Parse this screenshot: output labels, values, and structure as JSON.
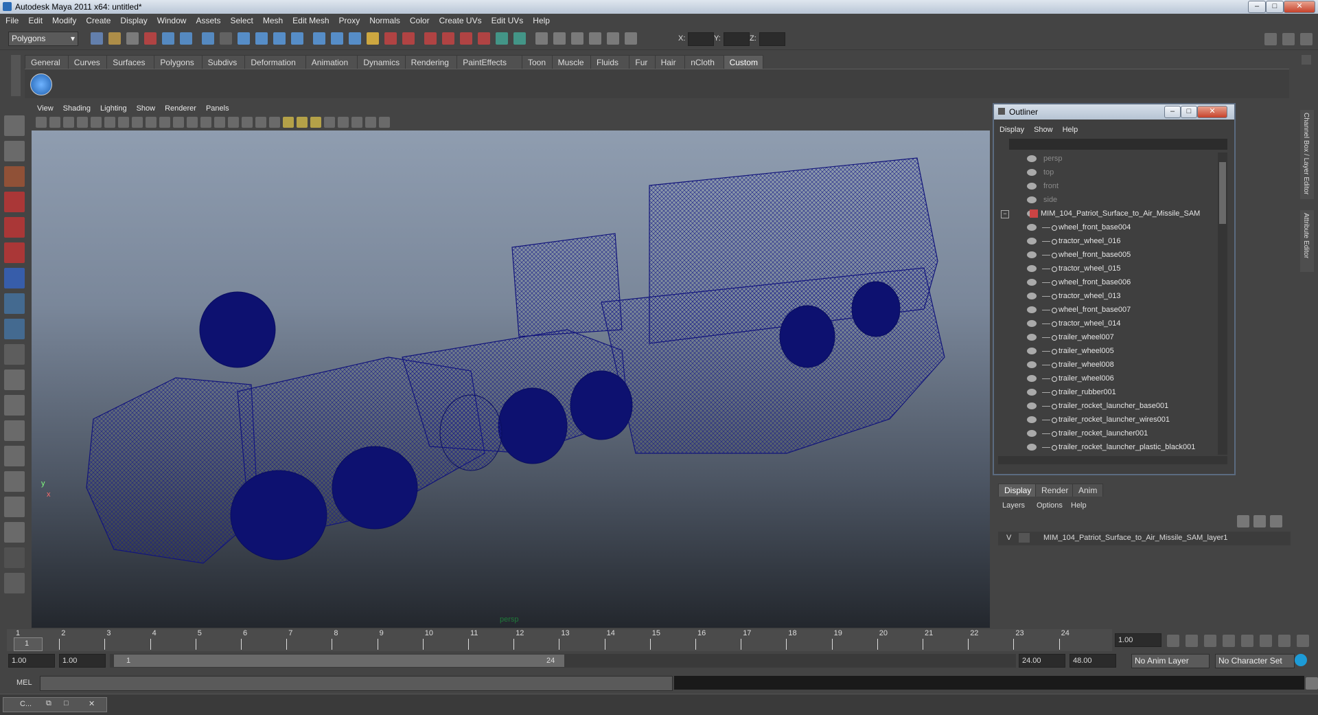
{
  "window": {
    "title": "Autodesk Maya 2011 x64: untitled*"
  },
  "menus": [
    "File",
    "Edit",
    "Modify",
    "Create",
    "Display",
    "Window",
    "Assets",
    "Select",
    "Mesh",
    "Edit Mesh",
    "Proxy",
    "Normals",
    "Color",
    "Create UVs",
    "Edit UVs",
    "Help"
  ],
  "status_line": {
    "mode": "Polygons",
    "x_label": "X:",
    "y_label": "Y:",
    "z_label": "Z:"
  },
  "shelf_tabs": [
    "General",
    "Curves",
    "Surfaces",
    "Polygons",
    "Subdivs",
    "Deformation",
    "Animation",
    "Dynamics",
    "Rendering",
    "PaintEffects",
    "Toon",
    "Muscle",
    "Fluids",
    "Fur",
    "Hair",
    "nCloth",
    "Custom"
  ],
  "active_shelf_tab": "Custom",
  "viewport": {
    "menus": [
      "View",
      "Shading",
      "Lighting",
      "Show",
      "Renderer",
      "Panels"
    ],
    "camera_label": "persp",
    "axis_y": "y",
    "axis_x": "x"
  },
  "outliner": {
    "title": "Outliner",
    "menus": [
      "Display",
      "Show",
      "Help"
    ],
    "items": [
      {
        "label": "persp",
        "dim": true
      },
      {
        "label": "top",
        "dim": true
      },
      {
        "label": "front",
        "dim": true
      },
      {
        "label": "side",
        "dim": true
      },
      {
        "label": "MIM_104_Patriot_Surface_to_Air_Missile_SAM",
        "dim": false
      },
      {
        "label": "wheel_front_base004",
        "dim": false
      },
      {
        "label": "tractor_wheel_016",
        "dim": false
      },
      {
        "label": "wheel_front_base005",
        "dim": false
      },
      {
        "label": "tractor_wheel_015",
        "dim": false
      },
      {
        "label": "wheel_front_base006",
        "dim": false
      },
      {
        "label": "tractor_wheel_013",
        "dim": false
      },
      {
        "label": "wheel_front_base007",
        "dim": false
      },
      {
        "label": "tractor_wheel_014",
        "dim": false
      },
      {
        "label": "trailer_wheel007",
        "dim": false
      },
      {
        "label": "trailer_wheel005",
        "dim": false
      },
      {
        "label": "trailer_wheel008",
        "dim": false
      },
      {
        "label": "trailer_wheel006",
        "dim": false
      },
      {
        "label": "trailer_rubber001",
        "dim": false
      },
      {
        "label": "trailer_rocket_launcher_base001",
        "dim": false
      },
      {
        "label": "trailer_rocket_launcher_wires001",
        "dim": false
      },
      {
        "label": "trailer_rocket_launcher001",
        "dim": false
      },
      {
        "label": "trailer_rocket_launcher_plastic_black001",
        "dim": false
      }
    ]
  },
  "side_tabs": {
    "channel_box": "Channel Box / Layer Editor",
    "attribute_editor": "Attribute Editor"
  },
  "layer_editor": {
    "tabs": [
      "Display",
      "Render",
      "Anim"
    ],
    "menus": [
      "Layers",
      "Options",
      "Help"
    ],
    "layer": {
      "visible_flag": "V",
      "name": "MIM_104_Patriot_Surface_to_Air_Missile_SAM_layer1"
    }
  },
  "timeline": {
    "ticks": [
      "1",
      "2",
      "3",
      "4",
      "5",
      "6",
      "7",
      "8",
      "9",
      "10",
      "11",
      "12",
      "13",
      "14",
      "15",
      "16",
      "17",
      "18",
      "19",
      "20",
      "21",
      "22",
      "23",
      "24"
    ],
    "current_frame_marker": "1",
    "current_time": "1.00"
  },
  "range": {
    "start": "1.00",
    "start2": "1.00",
    "slider_start": "1",
    "slider_end": "24",
    "end": "24.00",
    "end2": "48.00",
    "anim_layer": "No Anim Layer",
    "character_set": "No Character Set"
  },
  "command_line": {
    "label": "MEL"
  },
  "taskbar": {
    "item": "C..."
  }
}
